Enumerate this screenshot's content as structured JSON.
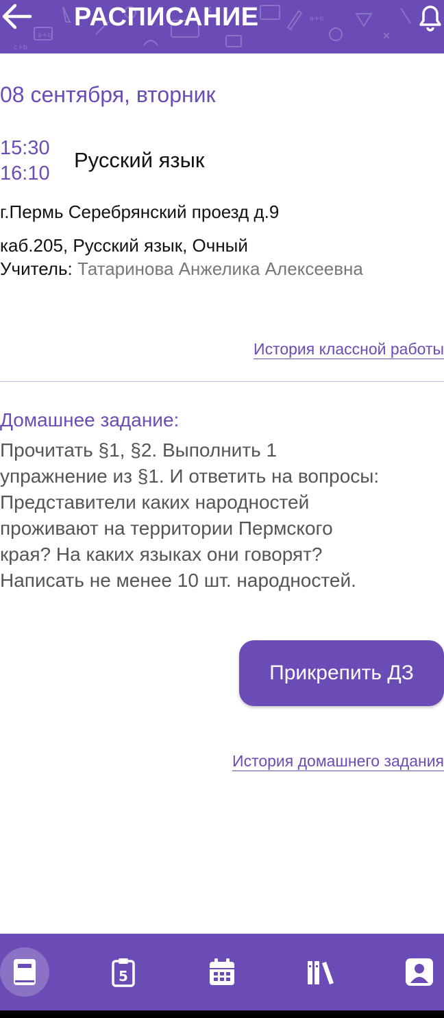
{
  "header": {
    "title": "РАСПИСАНИЕ",
    "back_icon": "arrow-left-icon",
    "bell_icon": "bell-icon"
  },
  "lesson": {
    "date": "08 сентября, вторник",
    "time_start": "15:30",
    "time_end": "16:10",
    "subject": "Русский язык",
    "address": "г.Пермь Серебрянский проезд д.9",
    "room_info": "каб.205, Русский язык, Очный",
    "teacher_label": "Учитель:",
    "teacher_name": "Татаринова Анжелика Алексеевна",
    "class_history_link": "История классной работы"
  },
  "homework": {
    "heading": "Домашнее задание:",
    "lines": [
      "Прочитать §1, §2. Выполнить 1",
      "упражнение из §1. И ответить на вопросы:",
      "Представители каких народностей",
      "проживают на территории Пермского",
      "края? На каких языках они говорят?",
      "Написать не менее 10 шт. народностей."
    ],
    "attach_button": "Прикрепить ДЗ",
    "history_link": "История домашнего задания"
  },
  "bottom_nav": {
    "items": [
      {
        "icon": "diary-book-icon",
        "active": true
      },
      {
        "icon": "grade-clipboard-icon",
        "active": false
      },
      {
        "icon": "calendar-icon",
        "active": false
      },
      {
        "icon": "library-books-icon",
        "active": false
      },
      {
        "icon": "profile-icon",
        "active": false
      }
    ]
  },
  "colors": {
    "accent": "#6b4bb5",
    "text": "#111111",
    "muted": "#777777",
    "homework_text": "#555555"
  }
}
